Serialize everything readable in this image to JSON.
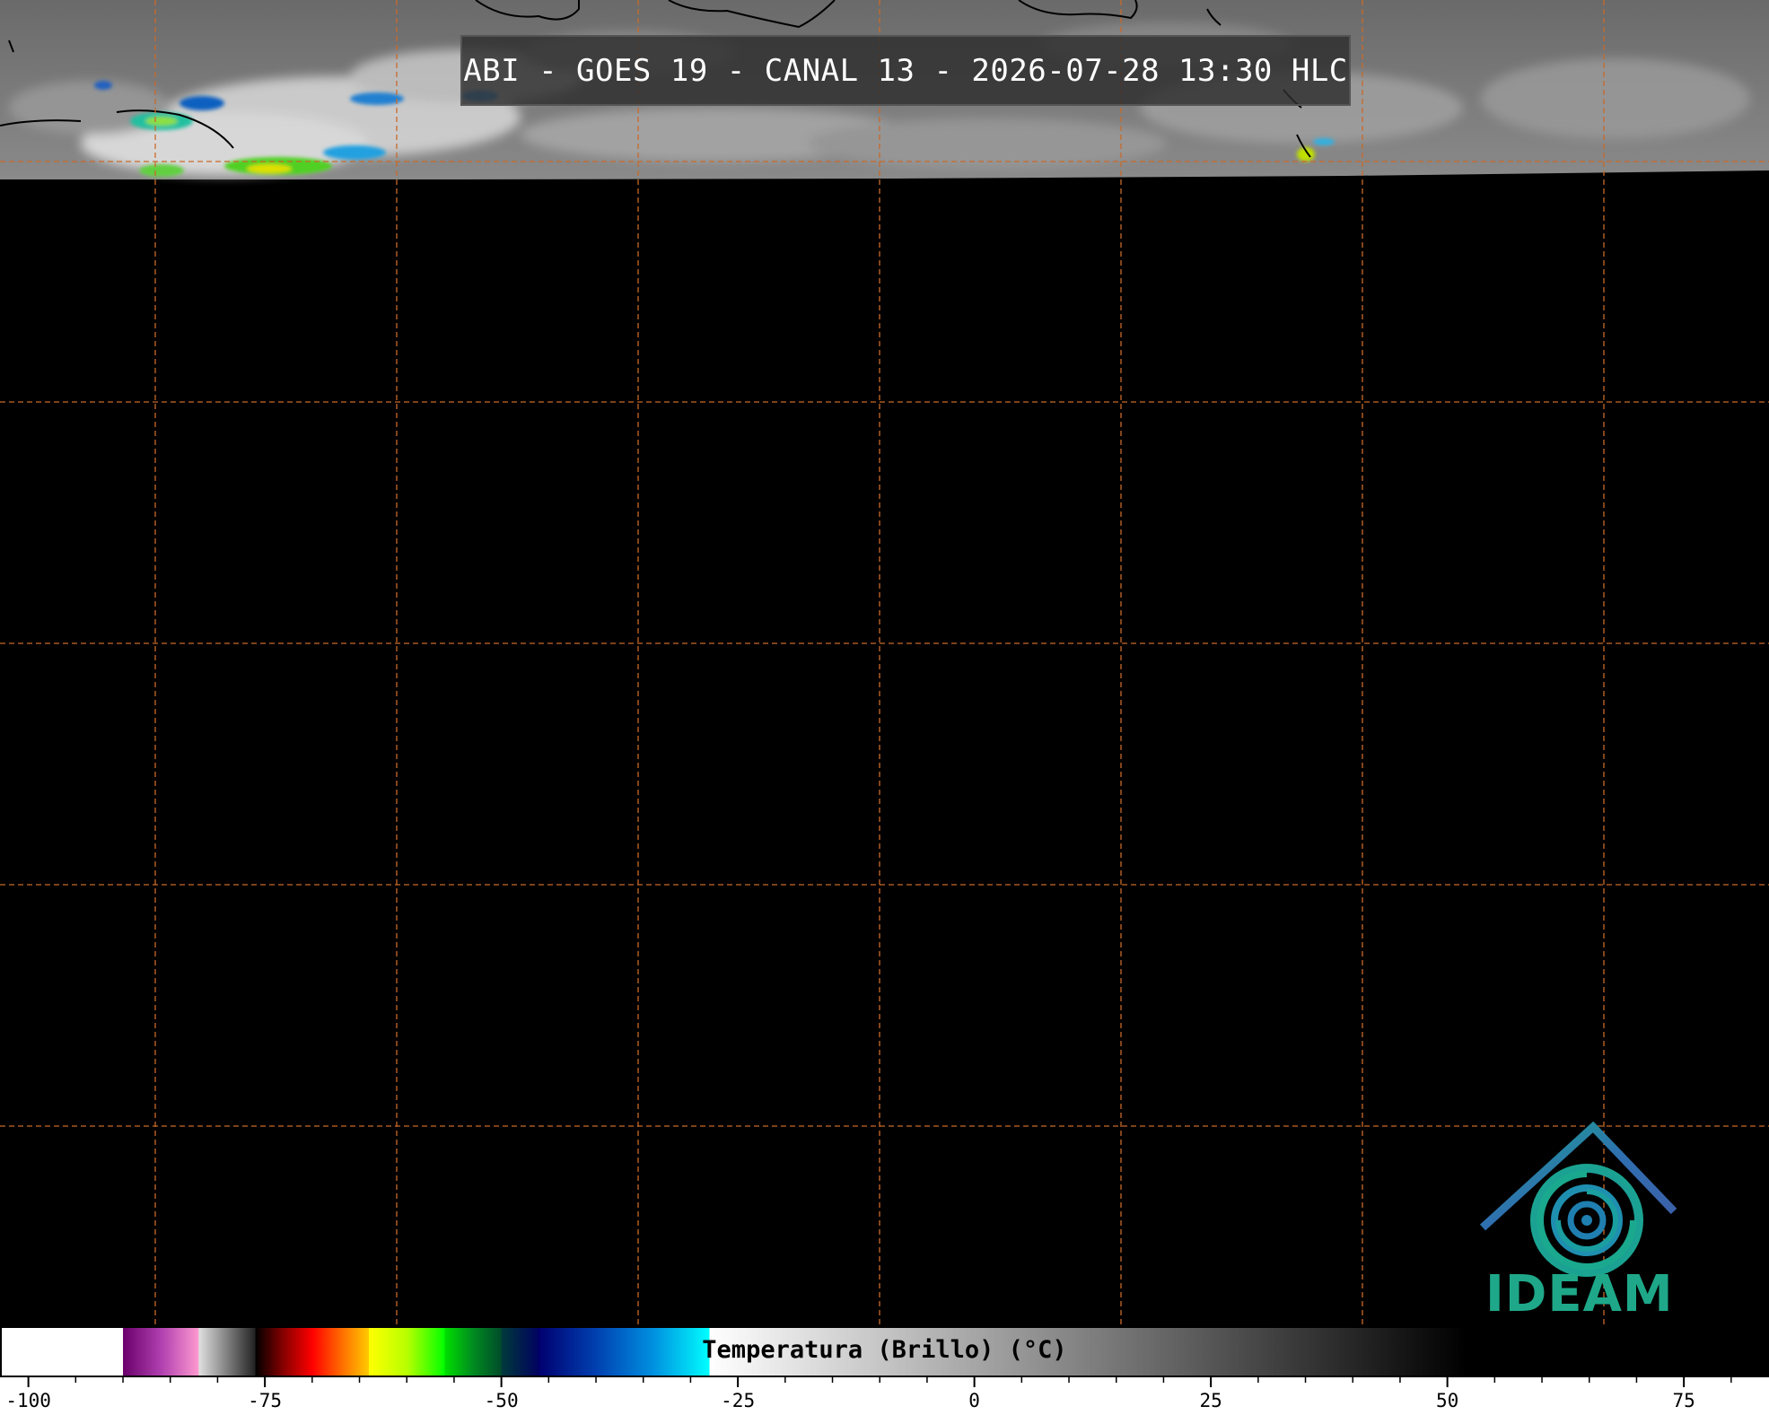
{
  "title": "ABI - GOES 19 - CANAL 13 - 2026-07-28 13:30 HLC",
  "logo": {
    "text": "IDEAM",
    "icon": "ideam-logo-icon",
    "color": "#1ea889"
  },
  "colorbar": {
    "label": "Temperatura (Brillo) (°C)",
    "range": [
      -103,
      84
    ],
    "tick_labels": [
      "-100",
      "-75",
      "-50",
      "-25",
      "0",
      "25",
      "50",
      "75"
    ],
    "tick_values": [
      -100,
      -75,
      -50,
      -25,
      0,
      25,
      50,
      75
    ],
    "minor_tick_step": 5,
    "segments": [
      {
        "from": -103,
        "to": -90,
        "color": "#ffffff"
      },
      {
        "from": -90,
        "to": -82,
        "color_stops": [
          "#6a006a",
          "#b03fb0",
          "#ff9ad0"
        ]
      },
      {
        "from": -82,
        "to": -76,
        "color_stops": [
          "#e0e0e0",
          "#808080",
          "#202020"
        ]
      },
      {
        "from": -76,
        "to": -64,
        "color_stops": [
          "#000000",
          "#8a0000",
          "#ff0000",
          "#ff6a00",
          "#ffcc00"
        ]
      },
      {
        "from": -64,
        "to": -56,
        "color_stops": [
          "#ffff00",
          "#b8ff00",
          "#00ff00"
        ]
      },
      {
        "from": -56,
        "to": -50,
        "color_stops": [
          "#00e000",
          "#008a20",
          "#004a2a"
        ]
      },
      {
        "from": -50,
        "to": -46,
        "color_stops": [
          "#003a3a",
          "#000060"
        ]
      },
      {
        "from": -46,
        "to": -28,
        "color_stops": [
          "#000070",
          "#0040b0",
          "#0090e0",
          "#00ffff"
        ]
      },
      {
        "from": -28,
        "to": 52,
        "color_stops": [
          "#ffffff",
          "#000000"
        ]
      },
      {
        "from": 52,
        "to": 84,
        "color": "#000000"
      }
    ]
  },
  "map": {
    "grid_color": "#c86a2a",
    "background": "#000000",
    "coverage": "partial-top-strip"
  }
}
